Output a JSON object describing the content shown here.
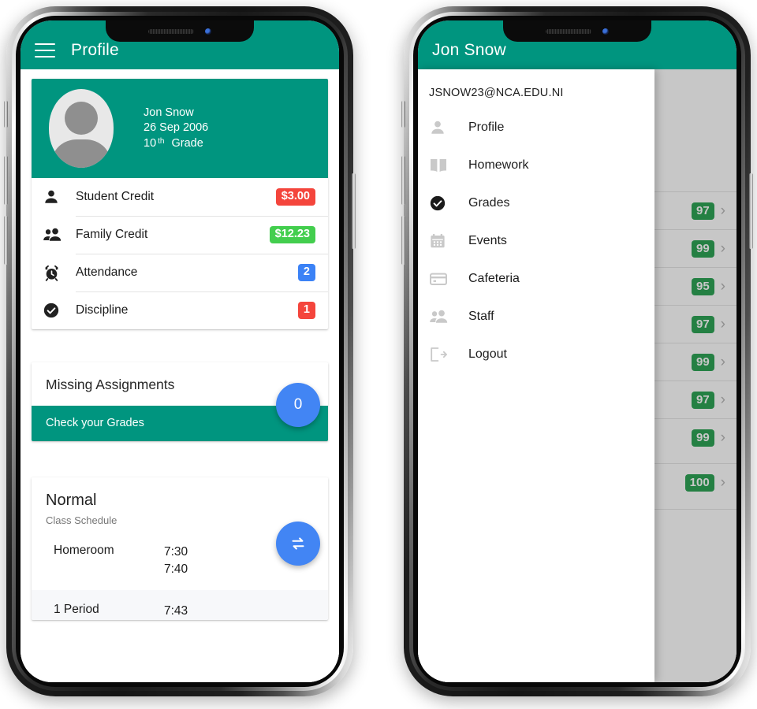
{
  "theme": {
    "primary": "#00957f",
    "accent_blue": "#4285f4",
    "badge_red": "#f4453c",
    "badge_green": "#43ce4e",
    "badge_blue": "#3b82f6",
    "grade_green": "#2fa457"
  },
  "left_phone": {
    "appbar": {
      "title": "Profile",
      "menu_icon": "hamburger-icon"
    },
    "profile": {
      "avatar_icon": "person-placeholder-avatar",
      "name": "Jon Snow",
      "birthdate": "26 Sep 2006",
      "grade_number": "10",
      "grade_suffix": "th",
      "grade_word": "Grade"
    },
    "summary_rows": [
      {
        "icon": "person-icon",
        "label": "Student Credit",
        "value": "$3.00",
        "value_color": "red"
      },
      {
        "icon": "people-icon",
        "label": "Family Credit",
        "value": "$12.23",
        "value_color": "green"
      },
      {
        "icon": "alarm-clock-icon",
        "label": "Attendance",
        "value": "2",
        "value_color": "blue"
      },
      {
        "icon": "check-circle-icon",
        "label": "Discipline",
        "value": "1",
        "value_color": "red"
      }
    ],
    "missing_assignments": {
      "title": "Missing Assignments",
      "action": "Check your Grades",
      "count_fab": "0",
      "count_fab_icon": "count-badge-fab"
    },
    "schedule": {
      "swap_fab_icon": "swap-arrows-icon",
      "title": "Normal",
      "subtitle": "Class Schedule",
      "rows": [
        {
          "name": "Homeroom",
          "start": "7:30",
          "end": "7:40"
        },
        {
          "name": "1 Period",
          "start": "7:43",
          "end": ""
        }
      ]
    }
  },
  "right_phone": {
    "appbar": {
      "title": "Jon Snow"
    },
    "drawer": {
      "email": "JSNOW23@NCA.EDU.NI",
      "items": [
        {
          "icon": "person-icon",
          "label": "Profile",
          "active": false
        },
        {
          "icon": "book-icon",
          "label": "Homework",
          "active": false
        },
        {
          "icon": "check-circle-icon",
          "label": "Grades",
          "active": true
        },
        {
          "icon": "calendar-icon",
          "label": "Events",
          "active": false
        },
        {
          "icon": "credit-card-icon",
          "label": "Cafeteria",
          "active": false
        },
        {
          "icon": "people-icon",
          "label": "Staff",
          "active": false
        },
        {
          "icon": "logout-icon",
          "label": "Logout",
          "active": false
        }
      ]
    },
    "background_grades": {
      "chevron_icon": "chevron-right-icon",
      "rows": [
        {
          "grade": "97"
        },
        {
          "grade": "99"
        },
        {
          "grade": "95"
        },
        {
          "grade": "97"
        },
        {
          "grade": "99"
        },
        {
          "grade": "97"
        },
        {
          "grade": "99"
        },
        {
          "grade": "100"
        }
      ]
    }
  }
}
